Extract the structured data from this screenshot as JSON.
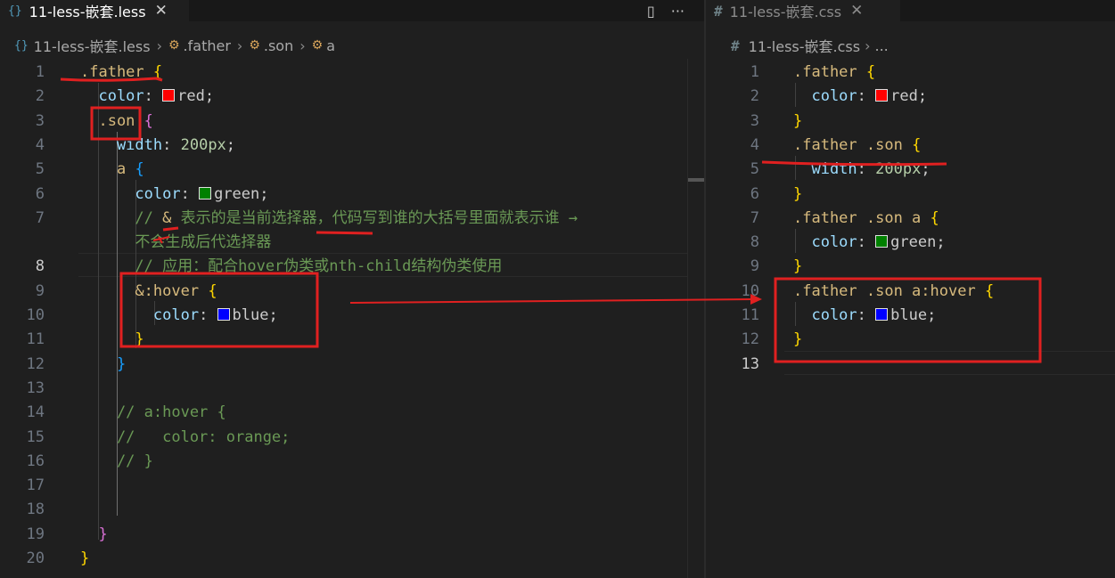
{
  "colors": {
    "accent_red": "#e02020",
    "swatch_red": "#ff0000",
    "swatch_green": "#008000",
    "swatch_blue": "#0000ff"
  },
  "left_editor": {
    "tab": {
      "icon": "less-file-icon",
      "icon_glyph": "{}",
      "label": "11-less-嵌套.less",
      "close_glyph": "✕"
    },
    "toolbar": {
      "split_glyph": "▯",
      "more_glyph": "···"
    },
    "breadcrumb": {
      "file_icon_glyph": "{}",
      "file": "11-less-嵌套.less",
      "symbol_glyph": "⚙",
      "items": [
        ".father",
        ".son",
        "a"
      ],
      "sep": "›"
    },
    "lines": [
      {
        "num": "1",
        "t": [
          [
            ".father",
            "sel"
          ],
          [
            " ",
            ""
          ],
          [
            "{",
            "b1"
          ]
        ]
      },
      {
        "num": "2",
        "t": [
          [
            "  color",
            "prop"
          ],
          [
            ": ",
            "val"
          ],
          [
            "#SW:swatch_red",
            ""
          ],
          [
            "red",
            "val"
          ],
          [
            ";",
            "val"
          ]
        ]
      },
      {
        "num": "3",
        "t": [
          [
            "  .son",
            "sel"
          ],
          [
            " ",
            ""
          ],
          [
            "{",
            "b2"
          ]
        ]
      },
      {
        "num": "4",
        "t": [
          [
            "    width",
            "prop"
          ],
          [
            ": ",
            "val"
          ],
          [
            "200px",
            "num"
          ],
          [
            ";",
            "val"
          ]
        ]
      },
      {
        "num": "5",
        "t": [
          [
            "    a",
            "sel"
          ],
          [
            " ",
            ""
          ],
          [
            "{",
            "b3"
          ]
        ]
      },
      {
        "num": "6",
        "t": [
          [
            "      color",
            "prop"
          ],
          [
            ": ",
            "val"
          ],
          [
            "#SW:swatch_green",
            ""
          ],
          [
            "green",
            "val"
          ],
          [
            ";",
            "val"
          ]
        ]
      },
      {
        "num": "7",
        "t": [
          [
            "      // ",
            "cmt"
          ],
          [
            "&",
            "amp"
          ],
          [
            " 表示的是当前选择器，代码写到谁的大括号里面就表示谁 →",
            "cmt"
          ]
        ]
      },
      {
        "num": "",
        "t": [
          [
            "      不会生成后代选择器",
            "cmt"
          ]
        ]
      },
      {
        "num": "8",
        "t": [
          [
            "      // 应用：配合hover伪类或nth-child结构伪类使用",
            "cmt"
          ]
        ],
        "active": true
      },
      {
        "num": "9",
        "t": [
          [
            "      &:hover",
            "sel"
          ],
          [
            " ",
            ""
          ],
          [
            "{",
            "b1"
          ]
        ]
      },
      {
        "num": "10",
        "t": [
          [
            "        color",
            "prop"
          ],
          [
            ": ",
            "val"
          ],
          [
            "#SW:swatch_blue",
            ""
          ],
          [
            "blue",
            "val"
          ],
          [
            ";",
            "val"
          ]
        ]
      },
      {
        "num": "11",
        "t": [
          [
            "      }",
            "b1"
          ]
        ]
      },
      {
        "num": "12",
        "t": [
          [
            "    }",
            "b3"
          ]
        ]
      },
      {
        "num": "13",
        "t": []
      },
      {
        "num": "14",
        "t": [
          [
            "    // a:hover {",
            "cmt"
          ]
        ]
      },
      {
        "num": "15",
        "t": [
          [
            "    //   color: orange;",
            "cmt"
          ]
        ]
      },
      {
        "num": "16",
        "t": [
          [
            "    // }",
            "cmt"
          ]
        ]
      },
      {
        "num": "17",
        "t": []
      },
      {
        "num": "18",
        "t": []
      },
      {
        "num": "19",
        "t": [
          [
            "  }",
            "b2"
          ]
        ]
      },
      {
        "num": "20",
        "t": [
          [
            "}",
            "b1"
          ]
        ]
      }
    ]
  },
  "right_editor": {
    "tab": {
      "icon": "css-file-icon",
      "icon_glyph": "#",
      "label": "11-less-嵌套.css",
      "close_glyph": "✕"
    },
    "breadcrumb": {
      "file_icon_glyph": "#",
      "file": "11-less-嵌套.css",
      "sep": "›",
      "more": "..."
    },
    "lines": [
      {
        "num": "1",
        "t": [
          [
            ".father",
            "sel"
          ],
          [
            " ",
            ""
          ],
          [
            "{",
            "b1"
          ]
        ]
      },
      {
        "num": "2",
        "t": [
          [
            "  color",
            "prop"
          ],
          [
            ": ",
            "val"
          ],
          [
            "#SW:swatch_red",
            ""
          ],
          [
            "red",
            "val"
          ],
          [
            ";",
            "val"
          ]
        ]
      },
      {
        "num": "3",
        "t": [
          [
            "}",
            "b1"
          ]
        ]
      },
      {
        "num": "4",
        "t": [
          [
            ".father .son",
            "sel"
          ],
          [
            " ",
            ""
          ],
          [
            "{",
            "b1"
          ]
        ]
      },
      {
        "num": "5",
        "t": [
          [
            "  width",
            "prop"
          ],
          [
            ": ",
            "val"
          ],
          [
            "200px",
            "num"
          ],
          [
            ";",
            "val"
          ]
        ]
      },
      {
        "num": "6",
        "t": [
          [
            "}",
            "b1"
          ]
        ]
      },
      {
        "num": "7",
        "t": [
          [
            ".father .son a",
            "sel"
          ],
          [
            " ",
            ""
          ],
          [
            "{",
            "b1"
          ]
        ]
      },
      {
        "num": "8",
        "t": [
          [
            "  color",
            "prop"
          ],
          [
            ": ",
            "val"
          ],
          [
            "#SW:swatch_green",
            ""
          ],
          [
            "green",
            "val"
          ],
          [
            ";",
            "val"
          ]
        ]
      },
      {
        "num": "9",
        "t": [
          [
            "}",
            "b1"
          ]
        ]
      },
      {
        "num": "10",
        "t": [
          [
            ".father .son a:hover",
            "sel"
          ],
          [
            " ",
            ""
          ],
          [
            "{",
            "b1"
          ]
        ]
      },
      {
        "num": "11",
        "t": [
          [
            "  color",
            "prop"
          ],
          [
            ": ",
            "val"
          ],
          [
            "#SW:swatch_blue",
            ""
          ],
          [
            "blue",
            "val"
          ],
          [
            ";",
            "val"
          ]
        ]
      },
      {
        "num": "12",
        "t": [
          [
            "}",
            "b1"
          ]
        ]
      },
      {
        "num": "13",
        "t": [],
        "active": true
      }
    ]
  }
}
